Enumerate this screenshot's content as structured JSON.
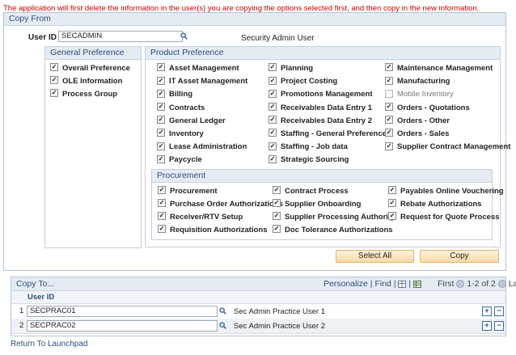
{
  "warning": "The application will first delete the information in the user(s) you are copying the options selected first, and then copy in the new information.",
  "copy_from": {
    "title": "Copy From",
    "user_id_label": "User ID",
    "user_id_value": "SECADMIN",
    "user_desc": "Security Admin User",
    "general_preference": {
      "title": "General Preference",
      "items": [
        {
          "label": "Overall Preference",
          "checked": true
        },
        {
          "label": "OLE Information",
          "checked": true
        },
        {
          "label": "Process Group",
          "checked": true
        }
      ]
    },
    "product_preference": {
      "title": "Product Preference",
      "col1": [
        {
          "label": "Asset Management",
          "checked": true
        },
        {
          "label": "IT Asset Management",
          "checked": true
        },
        {
          "label": "Billing",
          "checked": true
        },
        {
          "label": "Contracts",
          "checked": true
        },
        {
          "label": "General Ledger",
          "checked": true
        },
        {
          "label": "Inventory",
          "checked": true
        },
        {
          "label": "Lease Administration",
          "checked": true
        },
        {
          "label": "Paycycle",
          "checked": true
        }
      ],
      "col2": [
        {
          "label": "Planning",
          "checked": true
        },
        {
          "label": "Project Costing",
          "checked": true
        },
        {
          "label": "Promotions Management",
          "checked": true
        },
        {
          "label": "Receivables Data Entry 1",
          "checked": true
        },
        {
          "label": "Receivables Data Entry 2",
          "checked": true
        },
        {
          "label": "Staffing - General Preferences",
          "checked": true
        },
        {
          "label": "Staffing - Job data",
          "checked": true
        },
        {
          "label": "Strategic Sourcing",
          "checked": true
        }
      ],
      "col3": [
        {
          "label": "Maintenance Management",
          "checked": true
        },
        {
          "label": "Manufacturing",
          "checked": true
        },
        {
          "label": "Mobile Inventory",
          "checked": false
        },
        {
          "label": "Orders - Quotations",
          "checked": true
        },
        {
          "label": "Orders - Other",
          "checked": true
        },
        {
          "label": "Orders - Sales",
          "checked": true
        },
        {
          "label": "Supplier Contract Management",
          "checked": true
        }
      ]
    },
    "procurement": {
      "title": "Procurement",
      "col1": [
        {
          "label": "Procurement",
          "checked": true
        },
        {
          "label": "Purchase Order Authorizations",
          "checked": true
        },
        {
          "label": "Receiver/RTV Setup",
          "checked": true
        },
        {
          "label": "Requisition Authorizations",
          "checked": true
        }
      ],
      "col2": [
        {
          "label": "Contract Process",
          "checked": true
        },
        {
          "label": "Supplier Onboarding",
          "checked": true
        },
        {
          "label": "Supplier Processing Authority",
          "checked": true
        },
        {
          "label": "Doc Tolerance Authorizations",
          "checked": true
        }
      ],
      "col3": [
        {
          "label": "Payables Online Vouchering",
          "checked": true
        },
        {
          "label": "Rebate Authorizations",
          "checked": true
        },
        {
          "label": "Request for Quote Process",
          "checked": true
        }
      ]
    },
    "select_all_label": "Select All",
    "copy_label": "Copy"
  },
  "copy_to": {
    "title": "Copy To...",
    "personalize": "Personalize",
    "separator": "|",
    "find": "Find",
    "first": "First",
    "range": "1-2 of 2",
    "last": "Last",
    "column_header": "User ID",
    "rows": [
      {
        "num": "1",
        "user_id": "SECPRAC01",
        "desc": "Sec Admin Practice User 1"
      },
      {
        "num": "2",
        "user_id": "SECPRAC02",
        "desc": "Sec Admin Practice User 2"
      }
    ]
  },
  "return_link": "Return To Launchpad",
  "icons": {
    "lookup": "magnifier-icon",
    "add_row": "plus-icon",
    "delete_row": "minus-icon",
    "grid_view": "grid-icon",
    "download": "spreadsheet-icon",
    "prev": "prev-arrow-icon",
    "next": "next-arrow-icon"
  }
}
